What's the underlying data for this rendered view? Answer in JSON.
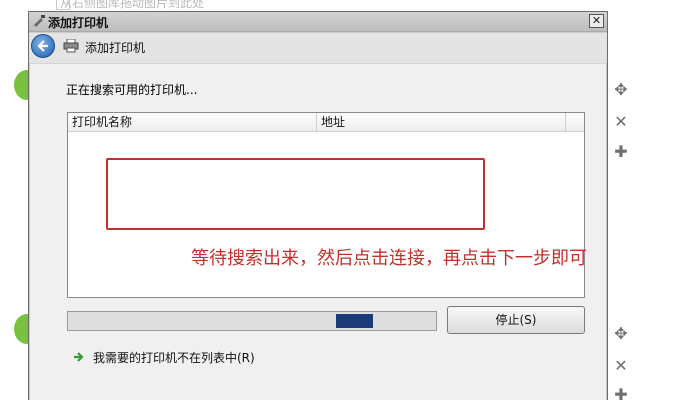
{
  "background": {
    "hint_text": "从右侧图库拖动图片到此处",
    "side_icons": [
      "move-icon",
      "close-icon",
      "plus-icon",
      "move-icon",
      "close-icon",
      "plus-icon"
    ]
  },
  "window": {
    "title": "添加打印机",
    "close_label": "✕"
  },
  "header": {
    "title": "添加打印机"
  },
  "content": {
    "searching_text": "正在搜索可用的打印机...",
    "list": {
      "columns": [
        "打印机名称",
        "地址"
      ]
    },
    "annotation": "等待搜索出来，然后点击连接，再点击下一步即可",
    "progress": {
      "value": 0.1,
      "position": 0.81
    },
    "stop_button": "停止(S)",
    "not_listed_link": "我需要的打印机不在列表中(R)"
  },
  "colors": {
    "annotation": "#c4302b",
    "progress_fill": "#1d3a78",
    "back_button": "#1e5fae"
  }
}
